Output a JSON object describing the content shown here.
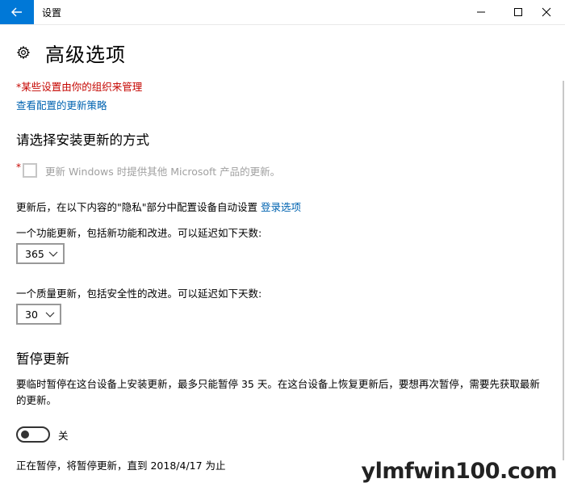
{
  "window": {
    "title": "设置",
    "back_icon": "back-arrow-icon",
    "controls": [
      "minimize-icon",
      "maximize-icon",
      "close-icon"
    ],
    "accent": "#0078d7"
  },
  "header": {
    "icon": "gear-icon",
    "title": "高级选项"
  },
  "managed_notice": "*某些设置由你的组织来管理",
  "policy_link": "查看配置的更新策略",
  "install_section": {
    "heading": "请选择安装更新的方式",
    "checkbox_asterisk": "*",
    "checkbox_label": "更新 Windows 时提供其他 Microsoft 产品的更新。",
    "checkbox_checked": false,
    "signin_text": "更新后，在以下内容的\"隐私\"部分中配置设备自动设置",
    "signin_link": "登录选项"
  },
  "feature_update": {
    "label": "一个功能更新，包括新功能和改进。可以延迟如下天数:",
    "value": "365"
  },
  "quality_update": {
    "label": "一个质量更新，包括安全性的改进。可以延迟如下天数:",
    "value": "30"
  },
  "pause_section": {
    "heading": "暂停更新",
    "description": "要临时暂停在这台设备上安装更新，最多只能暂停 35 天。在这台设备上恢复更新后，要想再次暂停，需要先获取最新的更新。",
    "toggle_state": "关",
    "toggle_on": false,
    "status": "正在暂停，将暂停更新，直到 2018/4/17 为止"
  },
  "watermark": "ylmfwin100.com",
  "colors": {
    "warning": "#c50500",
    "link": "#0063b1",
    "disabled": "#a0a0a0"
  }
}
